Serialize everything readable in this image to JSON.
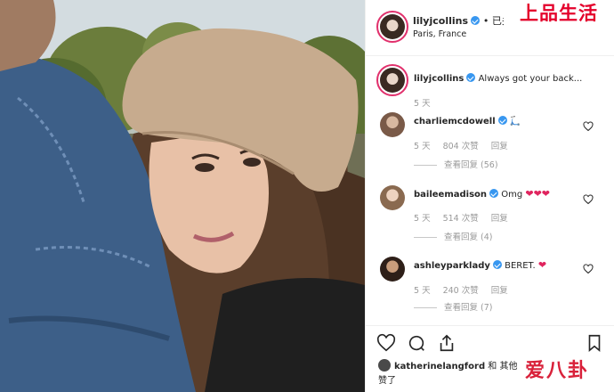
{
  "post": {
    "username": "lilyjcollins",
    "header_suffix": "• 已关",
    "location": "Paris, France"
  },
  "caption": {
    "username": "lilyjcollins",
    "text": "Always got your back...",
    "time": "5 天"
  },
  "comments": [
    {
      "username": "charliemcdowell",
      "text": "🛴",
      "time": "5 天",
      "likes": "804 次赞",
      "reply": "回复",
      "replies": "查看回复 (56)"
    },
    {
      "username": "baileemadison",
      "text": "Omg",
      "hearts": "❤❤❤",
      "time": "5 天",
      "likes": "514 次赞",
      "reply": "回复",
      "replies": "查看回复 (4)"
    },
    {
      "username": "ashleyparklady",
      "text": "BERET.",
      "hearts": "❤",
      "time": "5 天",
      "likes": "240 次赞",
      "reply": "回复",
      "replies": "查看回复 (7)"
    }
  ],
  "liked_by": {
    "prefix": "",
    "username": "katherinelangford",
    "suffix": "和 其他",
    "tail": "赞了"
  },
  "watermarks": {
    "top_right": "上品生活",
    "bottom_right": "爱八卦"
  },
  "icons": {
    "like": "heart-icon",
    "comment": "comment-icon",
    "share": "share-icon",
    "save": "bookmark-icon"
  },
  "colors": {
    "verified": "#3897f0",
    "heart": "#e0245e",
    "watermark": "#e4002b"
  }
}
